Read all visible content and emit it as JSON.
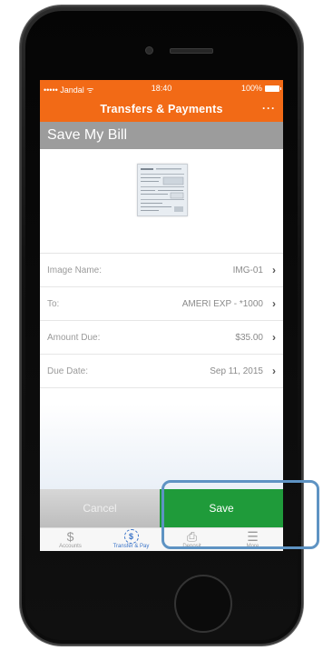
{
  "status_bar": {
    "carrier": "••••• Jandal ᯤ",
    "time": "18:40",
    "battery": "100%"
  },
  "nav": {
    "title": "Transfers & Payments",
    "more": "···"
  },
  "section": {
    "title": "Save My Bill"
  },
  "bill_details": [
    {
      "label": "Image Name:",
      "value": "IMG-01"
    },
    {
      "label": "To:",
      "value": "AMERI EXP - *1000"
    },
    {
      "label": "Amount Due:",
      "value": "$35.00"
    },
    {
      "label": "Due Date:",
      "value": "Sep 11, 2015"
    }
  ],
  "actions": {
    "cancel": "Cancel",
    "save": "Save"
  },
  "tabs": [
    {
      "label": "Accounts",
      "icon": "$",
      "icon_name": "dollar-icon"
    },
    {
      "label": "Transfer & Pay",
      "icon": "$",
      "icon_name": "transfer-pay-icon"
    },
    {
      "label": "Deposit",
      "icon": "⎙",
      "icon_name": "deposit-icon"
    },
    {
      "label": "More",
      "icon": "☰",
      "icon_name": "menu-icon"
    }
  ],
  "colors": {
    "brand_orange": "#f26a16",
    "save_green": "#1f9b3a",
    "active_blue": "#3b74c8",
    "highlight_blue": "#5e93c3"
  }
}
